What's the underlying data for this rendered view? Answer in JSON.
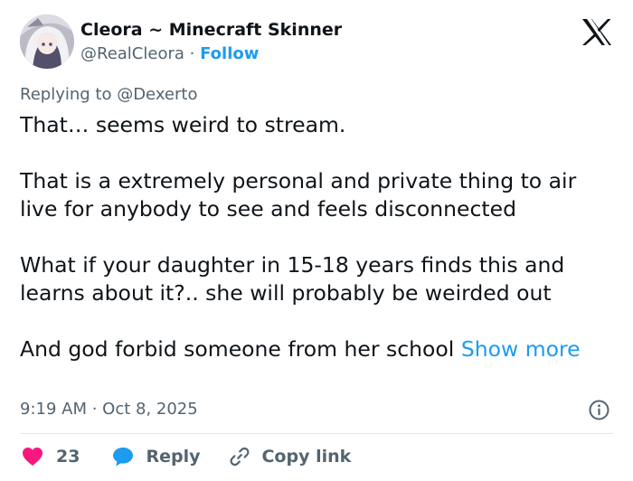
{
  "author": {
    "display_name": "Cleora ~ Minecraft Skinner",
    "handle": "@RealCleora",
    "separator": "·",
    "follow_label": "Follow"
  },
  "reply_context": "Replying to @Dexerto",
  "tweet": {
    "paragraph_1": "That… seems weird to stream.",
    "paragraph_2": "That is a extremely personal and private thing to air live for anybody to see and feels disconnected",
    "paragraph_3": "What if your daughter in 15-18 years finds this and learns about it?.. she will probably be weirded out",
    "paragraph_4": "And god forbid someone from her school",
    "show_more_label": "Show more"
  },
  "timestamp": "9:19 AM · Oct 8, 2025",
  "actions": {
    "like_count": "23",
    "reply_label": "Reply",
    "copy_link_label": "Copy link"
  },
  "icons": {
    "brand": "x-logo-icon",
    "like": "heart-icon",
    "reply": "speech-bubble-icon",
    "copy": "link-icon",
    "info": "info-icon"
  },
  "colors": {
    "accent": "#1d9bf0",
    "like": "#f91880",
    "text": "#0f1419",
    "muted": "#536471",
    "divider": "#e1e8ed"
  }
}
